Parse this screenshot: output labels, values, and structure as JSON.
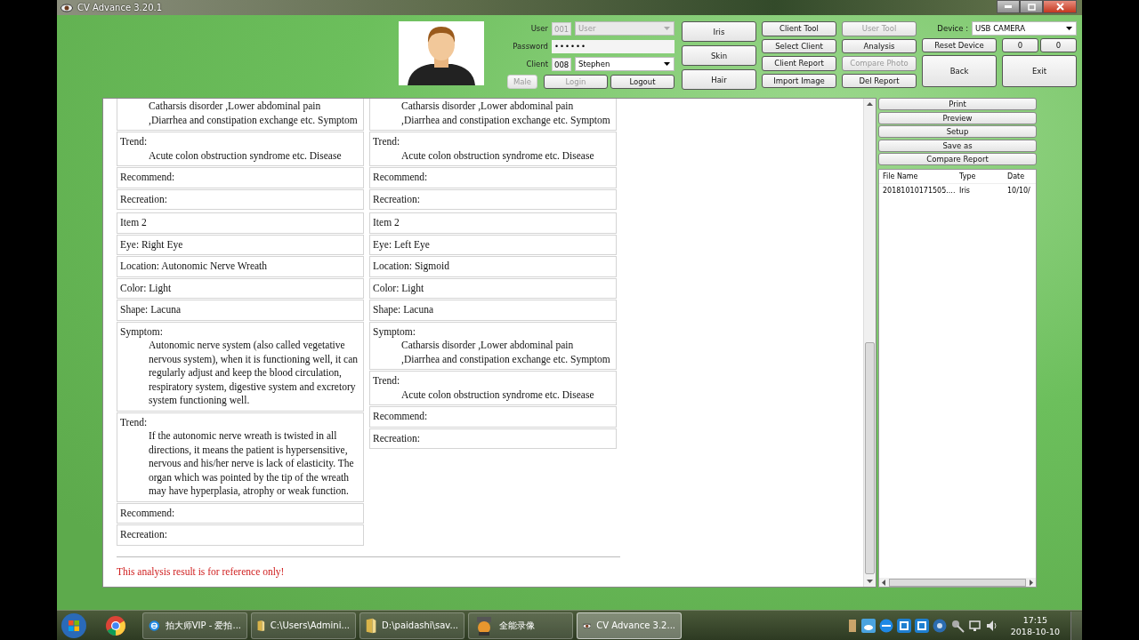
{
  "window": {
    "title": "CV Advance 3.20.1"
  },
  "login": {
    "rows": [
      {
        "label": "User",
        "code": "001",
        "value": "User",
        "kind": "dropdown",
        "disabled": true
      },
      {
        "label": "Password",
        "value": "••••••",
        "kind": "password",
        "disabled": false
      },
      {
        "label": "Client",
        "code": "008",
        "value": "Stephen",
        "kind": "dropdown",
        "disabled": false
      }
    ],
    "buttons": [
      {
        "label": "Male",
        "disabled": true
      },
      {
        "label": "Login",
        "disabled": true
      },
      {
        "label": "Logout",
        "disabled": false
      }
    ]
  },
  "modes": [
    "Iris",
    "Skin",
    "Hair"
  ],
  "tool_columns": [
    [
      {
        "label": "Client Tool",
        "disabled": false
      },
      {
        "label": "Select Client",
        "disabled": false
      },
      {
        "label": "Client Report",
        "disabled": false
      },
      {
        "label": "Import Image",
        "disabled": false
      }
    ],
    [
      {
        "label": "User Tool",
        "disabled": true
      },
      {
        "label": "Analysis",
        "disabled": false
      },
      {
        "label": "Compare Photo",
        "disabled": true
      },
      {
        "label": "Del Report",
        "disabled": false
      }
    ]
  ],
  "device": {
    "label": "Device :",
    "value": "USB CAMERA"
  },
  "device_buttons": [
    "Reset Device",
    "0",
    "0"
  ],
  "nav_buttons": [
    "Back",
    "Exit"
  ],
  "report": {
    "columns": [
      {
        "groups": [
          {
            "rows": [
              {
                "detail": "Catharsis disorder ,Lower abdominal pain ,Diarrhea and constipation exchange etc. Symptom"
              },
              {
                "label": "Trend:",
                "detail": "Acute colon obstruction syndrome etc. Disease"
              },
              {
                "label": "Recommend:"
              },
              {
                "label": "Recreation:"
              }
            ]
          },
          {
            "rows": [
              {
                "label": "Item 2"
              },
              {
                "label": "Eye: Right Eye"
              },
              {
                "label": "Location: Autonomic Nerve Wreath"
              },
              {
                "label": "Color: Light"
              },
              {
                "label": "Shape: Lacuna"
              },
              {
                "label": "Symptom:",
                "detail": "Autonomic nerve system (also called vegetative nervous system), when it is functioning well, it can regularly adjust and keep the blood circulation, respiratory system, digestive system and excretory system functioning well."
              },
              {
                "label": "Trend:",
                "detail": "If the autonomic nerve wreath is twisted in all directions, it means the patient is hypersensitive, nervous and his/her nerve is lack of elasticity. The organ which was pointed by the tip of the wreath may have hyperplasia, atrophy or weak function."
              },
              {
                "label": "Recommend:"
              },
              {
                "label": "Recreation:"
              }
            ]
          }
        ]
      },
      {
        "groups": [
          {
            "rows": [
              {
                "detail": "Catharsis disorder ,Lower abdominal pain ,Diarrhea and constipation exchange etc. Symptom"
              },
              {
                "label": "Trend:",
                "detail": "Acute colon obstruction syndrome etc. Disease"
              },
              {
                "label": "Recommend:"
              },
              {
                "label": "Recreation:"
              }
            ]
          },
          {
            "rows": [
              {
                "label": "Item 2"
              },
              {
                "label": "Eye: Left Eye"
              },
              {
                "label": "Location: Sigmoid"
              },
              {
                "label": "Color: Light"
              },
              {
                "label": "Shape: Lacuna"
              },
              {
                "label": "Symptom:",
                "detail": "Catharsis disorder ,Lower abdominal pain ,Diarrhea and constipation exchange etc. Symptom"
              },
              {
                "label": "Trend:",
                "detail": "Acute colon obstruction syndrome etc. Disease"
              },
              {
                "label": "Recommend:"
              },
              {
                "label": "Recreation:"
              }
            ]
          }
        ]
      }
    ],
    "notice": "This analysis result is for reference only!"
  },
  "actions": [
    "Print",
    "Preview",
    "Setup",
    "Save as",
    "Compare Report"
  ],
  "files": {
    "columns": [
      "File Name",
      "Type",
      "Date"
    ],
    "rows": [
      [
        "20181010171505....",
        "Iris",
        "10/10/"
      ]
    ]
  },
  "taskbar": {
    "tasks": [
      {
        "label": "拍大师VIP - 爱拍...",
        "kind": "browser",
        "selected": false
      },
      {
        "label": "C:\\Users\\Admini...",
        "kind": "folder",
        "selected": false
      },
      {
        "label": "D:\\paidashi\\sav...",
        "kind": "folder",
        "selected": false
      },
      {
        "label": "全能录像",
        "kind": "recorder",
        "selected": false
      },
      {
        "label": "CV Advance 3.2...",
        "kind": "eye",
        "selected": true
      }
    ],
    "time": "17:15",
    "date": "2018-10-10"
  }
}
